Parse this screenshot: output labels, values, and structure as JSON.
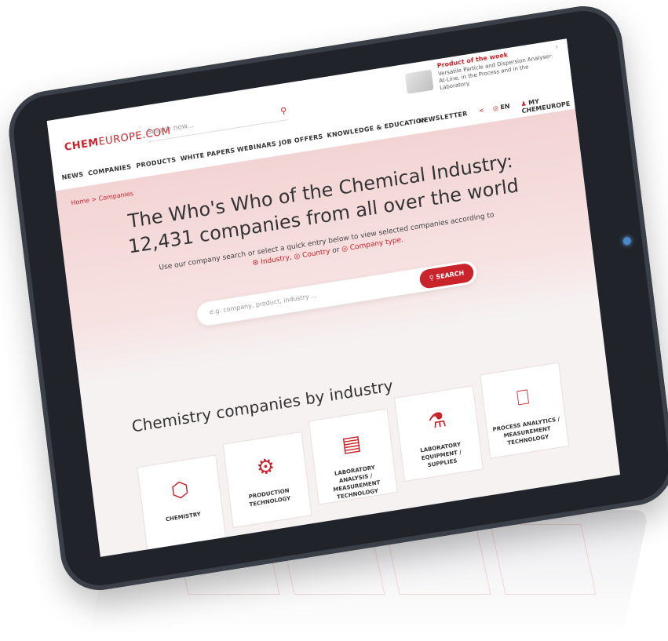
{
  "header": {
    "logo_bold": "CHEM",
    "logo_rest": "EUROPE.COM",
    "search_placeholder": "Search now...",
    "product_of_week": {
      "title": "Product of the week",
      "description": "Versatile Particle and Dispersion Analyser: At-Line, in the Process and in the Laboratory"
    }
  },
  "nav": {
    "items": [
      "NEWS",
      "COMPANIES",
      "PRODUCTS",
      "WHITE PAPERS",
      "WEBINARS",
      "JOB OFFERS",
      "KNOWLEDGE & EDUCATION",
      "NEWSLETTER"
    ],
    "lang": "EN",
    "my_account": "MY CHEMEUROPE"
  },
  "hero": {
    "breadcrumb": "Home > Companies",
    "title_line1": "The Who's Who of the Chemical Industry:",
    "title_line2": "12,431 companies from all over the world",
    "subtitle": "Use our company search or select a quick entry below to view selected companies according to",
    "filter_industry": "Industry",
    "filter_country": "Country",
    "filter_type": "Company type.",
    "search_placeholder": "e.g. company, product, industry ...",
    "search_button": "SEARCH"
  },
  "section": {
    "title": "Chemistry companies by industry",
    "cards": [
      {
        "label": "CHEMISTRY",
        "icon": "hexagon-molecule-icon"
      },
      {
        "label": "PRODUCTION TECHNOLOGY",
        "icon": "gears-icon"
      },
      {
        "label": "LABORATORY ANALYSIS / MEASUREMENT TECHNOLOGY",
        "icon": "lab-analyzer-icon"
      },
      {
        "label": "LABORATORY EQUIPMENT / SUPPLIES",
        "icon": "flask-icon"
      },
      {
        "label": "PROCESS ANALYTICS / MEASUREMENT TECHNOLOGY",
        "icon": "monitor-graph-icon"
      }
    ]
  },
  "colors": {
    "accent": "#c9242b",
    "hero_bg": "#f3d4d4",
    "bezel": "#20232a"
  }
}
